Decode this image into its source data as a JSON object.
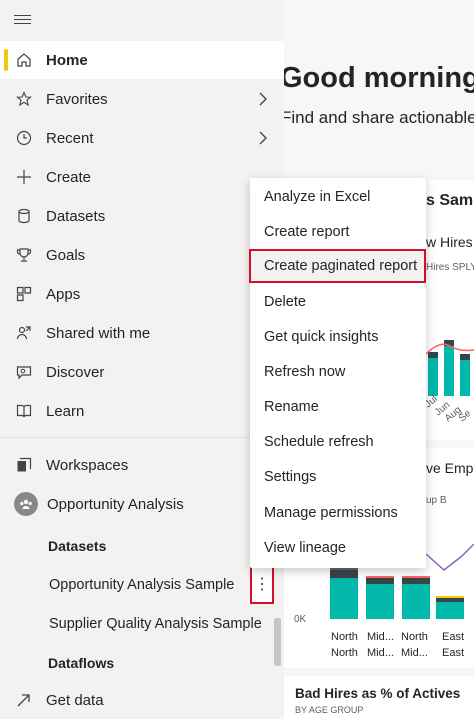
{
  "sidebar": {
    "menu_icon": "hamburger-icon",
    "items": [
      {
        "label": "Home",
        "icon": "home-icon",
        "active": true
      },
      {
        "label": "Favorites",
        "icon": "star-icon",
        "has_chevron": true
      },
      {
        "label": "Recent",
        "icon": "clock-icon",
        "has_chevron": true
      },
      {
        "label": "Create",
        "icon": "plus-icon"
      },
      {
        "label": "Datasets",
        "icon": "database-icon"
      },
      {
        "label": "Goals",
        "icon": "trophy-icon"
      },
      {
        "label": "Apps",
        "icon": "apps-icon"
      },
      {
        "label": "Shared with me",
        "icon": "shared-icon"
      },
      {
        "label": "Discover",
        "icon": "discover-icon"
      },
      {
        "label": "Learn",
        "icon": "book-icon"
      }
    ],
    "workspaces_label": "Workspaces",
    "workspace_name": "Opportunity Analysis",
    "datasets_heading": "Datasets",
    "datasets": [
      "Opportunity Analysis Sample",
      "Supplier Quality Analysis Sample"
    ],
    "dataflows_heading": "Dataflows",
    "get_data_label": "Get data"
  },
  "main": {
    "greeting": "Good morning,",
    "subtitle": "Find and share actionable",
    "card1_title": "s Samp",
    "card1_chart_title": "w Hires S",
    "card1_legend": "Hires SPLY",
    "card1_axis_labels": [
      "Jul",
      "Jun",
      "Aug",
      "Se"
    ],
    "card2_title": "ve Empl",
    "card2_legend": "up B",
    "card2_zero": "0K",
    "card2_xlabels_top": [
      "North",
      "Mid...",
      "North",
      "East"
    ],
    "card2_xlabels_bottom": [
      "North",
      "Mid...",
      "Mid...",
      "East"
    ],
    "card3_title": "Bad Hires as % of Actives",
    "card3_subtitle": "BY AGE GROUP"
  },
  "context_menu": {
    "items": [
      "Analyze in Excel",
      "Create report",
      "Create paginated report",
      "Delete",
      "Get quick insights",
      "Refresh now",
      "Rename",
      "Schedule refresh",
      "Settings",
      "Manage permissions",
      "View lineage"
    ],
    "highlighted": "Create paginated report"
  },
  "more_options_label": "⋮",
  "colors": {
    "accent": "#f2c811",
    "highlight_border": "#d0112b",
    "teal": "#01b8aa",
    "dark": "#374649",
    "coral": "#fd625e"
  }
}
